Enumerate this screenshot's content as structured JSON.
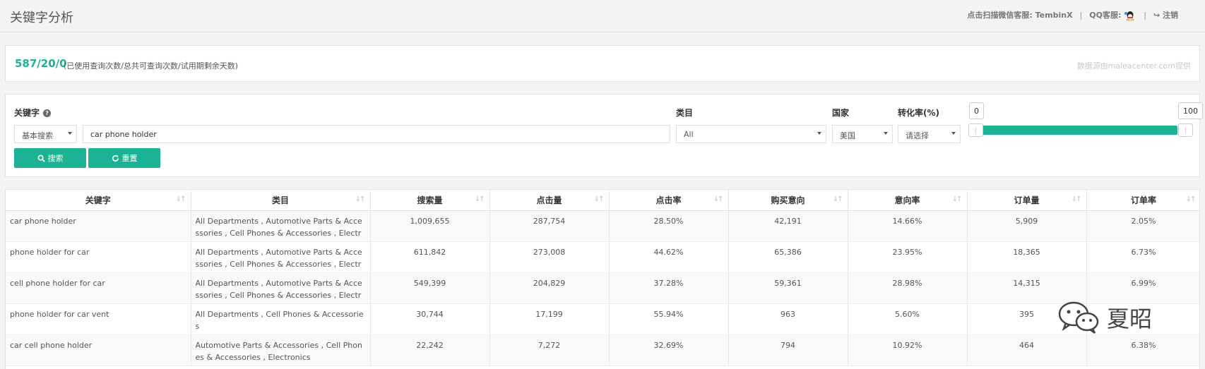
{
  "header": {
    "title": "关键字分析",
    "wechat_label": "点击扫描微信客服:",
    "wechat_name": "TembinX",
    "qq_label": "QQ客服:",
    "logout": "注销"
  },
  "usage": {
    "count": "587/20/0",
    "description": "(已使用查询次数/总共可查询次数/试用期剩余天数)",
    "source": "数据源由maleacenter.com提供"
  },
  "filters": {
    "keyword_label": "关键字",
    "search_mode": "基本搜索",
    "keyword_value": "car phone holder",
    "search_button": "搜索",
    "reset_button": "重置",
    "category_label": "类目",
    "category_value": "All",
    "country_label": "国家",
    "country_value": "美国",
    "conversion_label": "转化率(%)",
    "conversion_value": "请选择",
    "slider_min": "0",
    "slider_max": "100"
  },
  "table": {
    "columns": [
      "关键字",
      "类目",
      "搜索量",
      "点击量",
      "点击率",
      "购买意向",
      "意向率",
      "订单量",
      "订单率"
    ],
    "rows": [
      [
        "car phone holder",
        "All Departments , Automotive Parts & Accessories , Cell Phones & Accessories , Electronics",
        "1,009,655",
        "287,754",
        "28.50%",
        "42,191",
        "14.66%",
        "5,909",
        "2.05%"
      ],
      [
        "phone holder for car",
        "All Departments , Automotive Parts & Accessories , Cell Phones & Accessories , Electronics",
        "611,842",
        "273,008",
        "44.62%",
        "65,386",
        "23.95%",
        "18,365",
        "6.73%"
      ],
      [
        "cell phone holder for car",
        "All Departments , Automotive Parts & Accessories , Cell Phones & Accessories , Electronics",
        "549,399",
        "204,829",
        "37.28%",
        "59,361",
        "28.98%",
        "14,315",
        "6.99%"
      ],
      [
        "phone holder for car vent",
        "All Departments , Cell Phones & Accessories",
        "30,744",
        "17,199",
        "55.94%",
        "963",
        "5.60%",
        "395",
        ""
      ],
      [
        "car cell phone holder",
        "Automotive Parts & Accessories , Cell Phones & Accessories , Electronics",
        "22,242",
        "7,272",
        "32.69%",
        "794",
        "10.92%",
        "464",
        "6.38%"
      ]
    ]
  },
  "watermark": {
    "text": "夏昭"
  },
  "colors": {
    "accent": "#1ab394"
  }
}
